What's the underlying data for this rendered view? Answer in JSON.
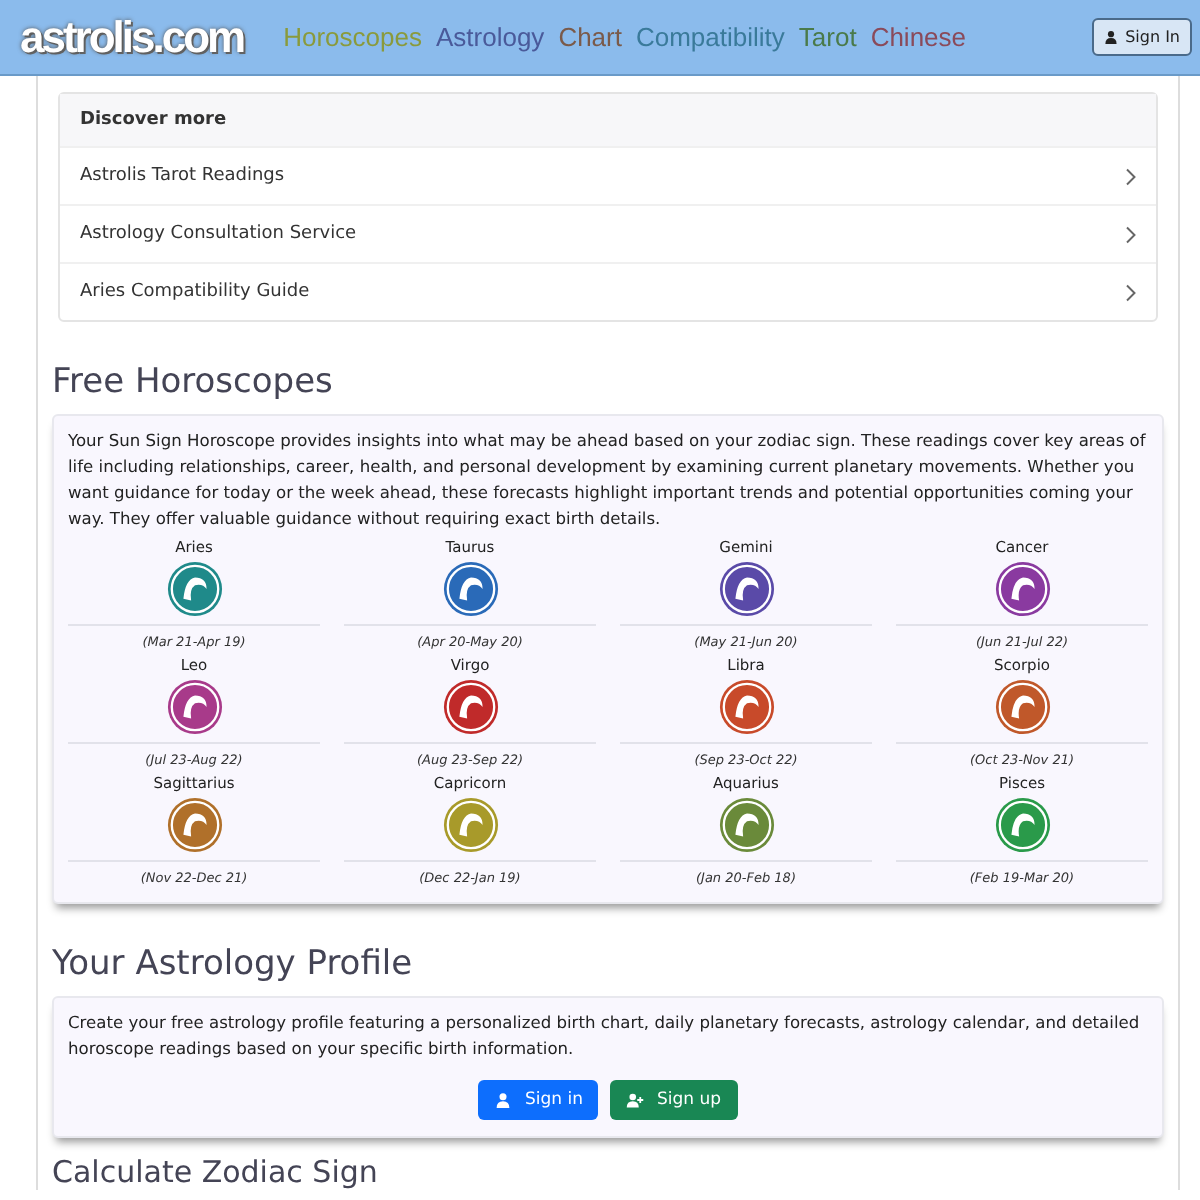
{
  "header": {
    "logo": "astrolis.com",
    "nav": [
      {
        "label": "Horoscopes",
        "color": "#8a9a3c"
      },
      {
        "label": "Astrology",
        "color": "#4a5a9a"
      },
      {
        "label": "Chart",
        "color": "#7a5a4a"
      },
      {
        "label": "Compatibility",
        "color": "#3a7a9a"
      },
      {
        "label": "Tarot",
        "color": "#4a7a4a"
      },
      {
        "label": "Chinese",
        "color": "#8a4a5a"
      }
    ],
    "sign_in": "Sign In"
  },
  "discover": {
    "title": "Discover more",
    "items": [
      "Astrolis Tarot Readings",
      "Astrology Consultation Service",
      "Aries Compatibility Guide"
    ]
  },
  "horoscopes": {
    "title": "Free Horoscopes",
    "intro": "Your Sun Sign Horoscope provides insights into what may be ahead based on your zodiac sign. These readings cover key areas of life including relationships, career, health, and personal development by examining current planetary movements. Whether you want guidance for today or the week ahead, these forecasts highlight important trends and potential opportunities coming your way. They offer valuable guidance without requiring exact birth details.",
    "signs": [
      {
        "name": "Aries",
        "dates": "(Mar 21-Apr 19)",
        "color": "#1f8a8a"
      },
      {
        "name": "Taurus",
        "dates": "(Apr 20-May 20)",
        "color": "#2a6ab8"
      },
      {
        "name": "Gemini",
        "dates": "(May 21-Jun 20)",
        "color": "#5a4aa8"
      },
      {
        "name": "Cancer",
        "dates": "(Jun 21-Jul 22)",
        "color": "#8a3aa0"
      },
      {
        "name": "Leo",
        "dates": "(Jul 23-Aug 22)",
        "color": "#a83a8a"
      },
      {
        "name": "Virgo",
        "dates": "(Aug 23-Sep 22)",
        "color": "#c02a2a"
      },
      {
        "name": "Libra",
        "dates": "(Sep 23-Oct 22)",
        "color": "#c84a2a"
      },
      {
        "name": "Scorpio",
        "dates": "(Oct 23-Nov 21)",
        "color": "#c0582a"
      },
      {
        "name": "Sagittarius",
        "dates": "(Nov 22-Dec 21)",
        "color": "#b0702a"
      },
      {
        "name": "Capricorn",
        "dates": "(Dec 22-Jan 19)",
        "color": "#a89a2a"
      },
      {
        "name": "Aquarius",
        "dates": "(Jan 20-Feb 18)",
        "color": "#6a8a3a"
      },
      {
        "name": "Pisces",
        "dates": "(Feb 19-Mar 20)",
        "color": "#2a9a4a"
      }
    ]
  },
  "profile": {
    "title": "Your Astrology Profile",
    "text": "Create your free astrology profile featuring a personalized birth chart, daily planetary forecasts, astrology calendar, and detailed horoscope readings based on your specific birth information.",
    "buttons": [
      {
        "label": "Sign in",
        "kind": "signin"
      },
      {
        "label": "Sign up",
        "kind": "signup"
      }
    ]
  },
  "calculate": {
    "title": "Calculate Zodiac Sign"
  }
}
